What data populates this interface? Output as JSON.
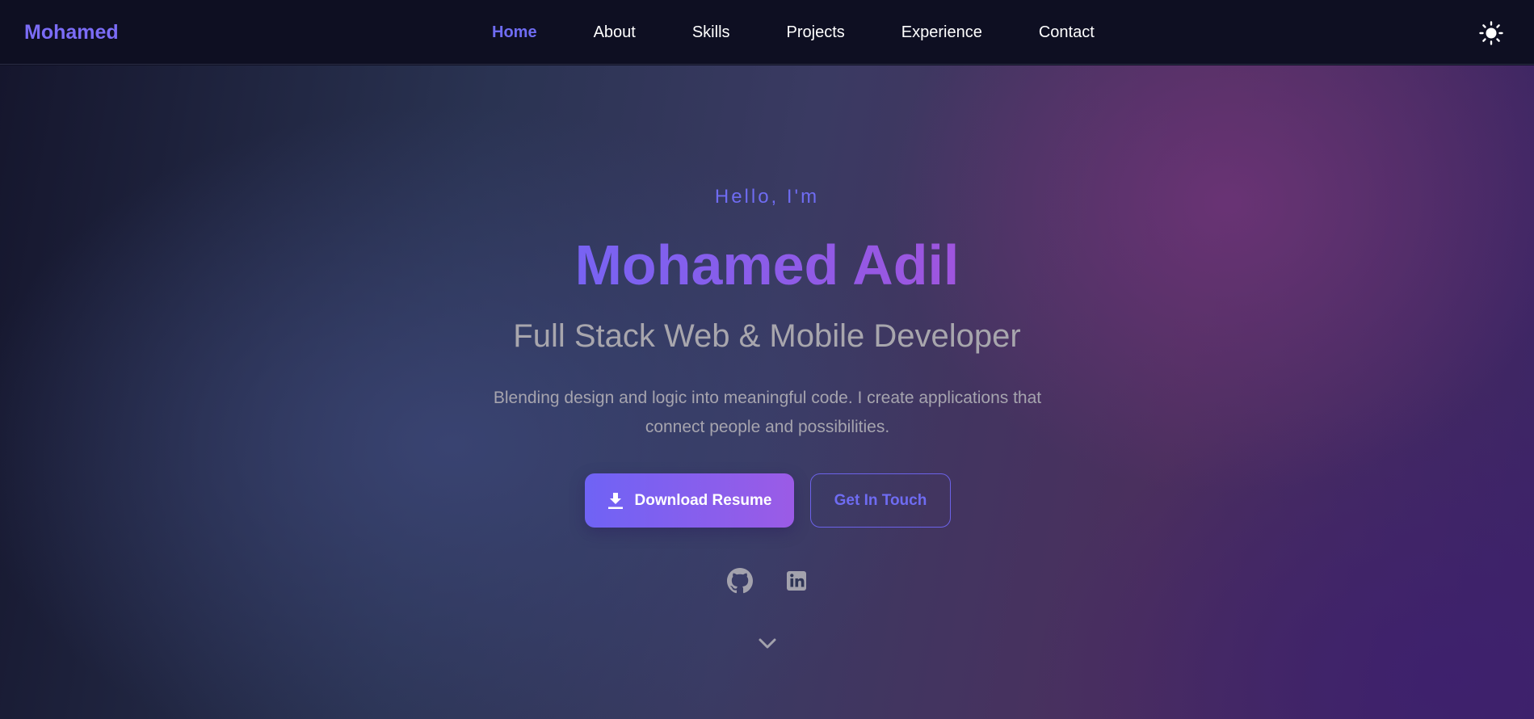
{
  "nav": {
    "brand": "Mohamed",
    "links": [
      {
        "label": "Home",
        "active": true
      },
      {
        "label": "About",
        "active": false
      },
      {
        "label": "Skills",
        "active": false
      },
      {
        "label": "Projects",
        "active": false
      },
      {
        "label": "Experience",
        "active": false
      },
      {
        "label": "Contact",
        "active": false
      }
    ],
    "theme_toggle_icon": "sun-icon"
  },
  "hero": {
    "greeting": "Hello, I'm",
    "name": "Mohamed Adil",
    "role": "Full Stack Web & Mobile Developer",
    "description": "Blending design and logic into meaningful code. I create applications that connect people and possibilities.",
    "primary_button": {
      "label": "Download Resume",
      "icon": "download-icon"
    },
    "secondary_button": {
      "label": "Get In Touch"
    },
    "social_icons": [
      "github-icon",
      "linkedin-icon"
    ],
    "scroll_icon": "chevron-down-icon"
  },
  "colors": {
    "accent": "#6f6cf2",
    "name_gradient_start": "#7863f3",
    "name_gradient_end": "#9f55de",
    "nav_background": "#0e0f22"
  }
}
